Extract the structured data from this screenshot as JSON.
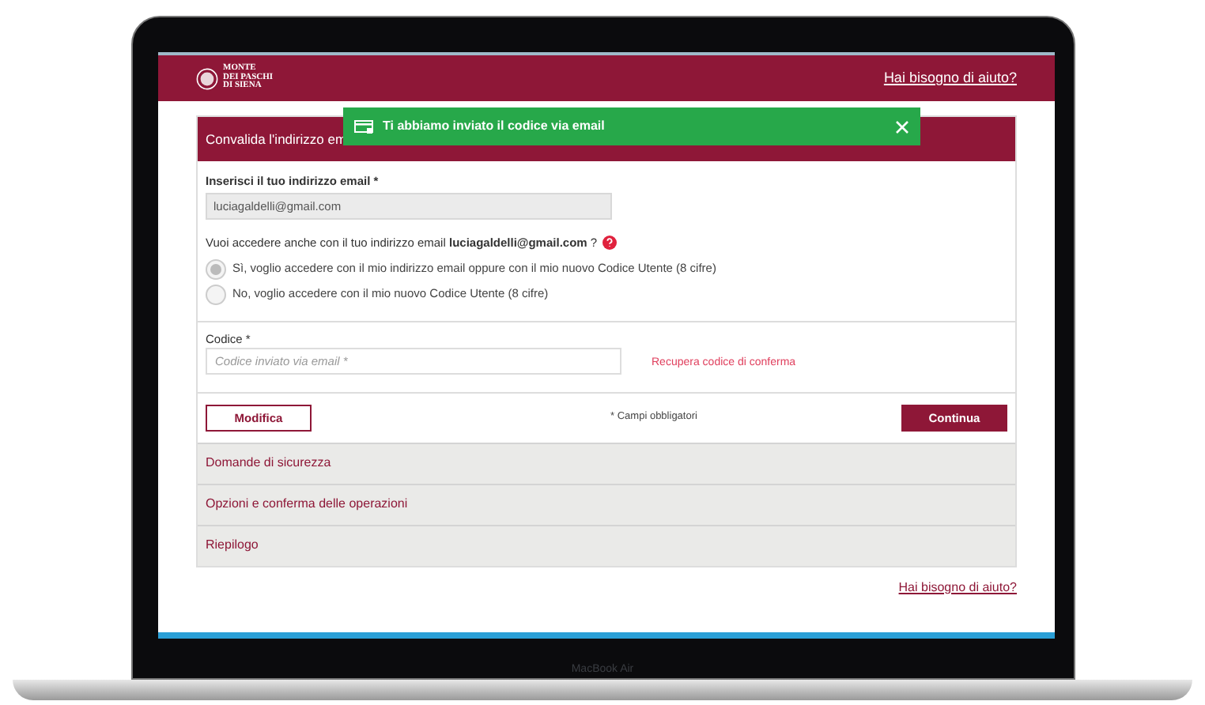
{
  "laptop": {
    "model_label": "MacBook Air"
  },
  "header": {
    "logo_lines": [
      "MONTE",
      "DEI PASCHI",
      "DI SIENA"
    ],
    "help_link": "Hai bisogno di aiuto?"
  },
  "toast": {
    "message": "Ti abbiamo inviato il codice via email"
  },
  "section": {
    "title": "Convalida l'indirizzo em",
    "email_label": "Inserisci il tuo indirizzo email *",
    "email_value": "luciagaldelli@gmail.com",
    "question": "Vuoi accedere anche con il tuo indirizzo email **luciagaldelli@gmail.com** ?",
    "options": [
      {
        "label": "Sì, voglio accedere con il mio indirizzo email oppure con il mio nuovo Codice Utente (8 cifre)",
        "selected": true
      },
      {
        "label": "No, voglio accedere con il mio nuovo Codice Utente (8 cifre)",
        "selected": false
      }
    ],
    "code_label": "Codice *",
    "code_placeholder": "Codice inviato via email *",
    "recover_link": "Recupera codice di conferma",
    "modify_button": "Modifica",
    "required_note": "* Campi obbligatori",
    "continue_button": "Continua"
  },
  "steps": [
    "Domande di sicurezza",
    "Opzioni e conferma delle operazioni",
    "Riepilogo"
  ],
  "footer_help_link": "Hai bisogno di aiuto?"
}
